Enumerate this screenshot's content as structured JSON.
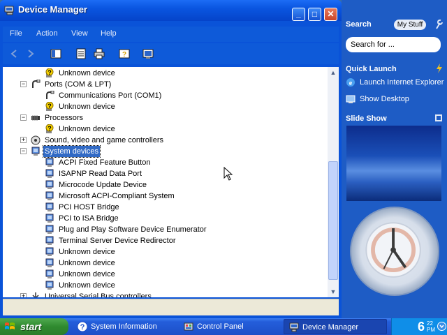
{
  "window": {
    "title": "Device Manager",
    "buttons": {
      "minimize": "_",
      "maximize": "□",
      "close": "✕"
    }
  },
  "menu": [
    "File",
    "Action",
    "View",
    "Help"
  ],
  "toolbar": [
    "back-icon",
    "forward-icon",
    "console-tree-icon",
    "properties-icon",
    "print-icon",
    "help-icon",
    "scan-hardware-icon"
  ],
  "tree": {
    "rows": [
      {
        "label": "Unknown device",
        "indent": 3,
        "icon": "warning-device"
      },
      {
        "label": "Ports (COM & LPT)",
        "indent": 2,
        "icon": "port",
        "expander": "−"
      },
      {
        "label": "Communications Port (COM1)",
        "indent": 3,
        "icon": "port"
      },
      {
        "label": "Unknown device",
        "indent": 3,
        "icon": "warning-device"
      },
      {
        "label": "Processors",
        "indent": 2,
        "icon": "processor",
        "expander": "−"
      },
      {
        "label": "Unknown device",
        "indent": 3,
        "icon": "warning-device"
      },
      {
        "label": "Sound, video and game controllers",
        "indent": 2,
        "icon": "sound",
        "expander": "+"
      },
      {
        "label": "System devices",
        "indent": 2,
        "icon": "system",
        "expander": "−",
        "selected": true
      },
      {
        "label": "ACPI Fixed Feature Button",
        "indent": 3,
        "icon": "system"
      },
      {
        "label": "ISAPNP Read Data Port",
        "indent": 3,
        "icon": "system"
      },
      {
        "label": "Microcode Update Device",
        "indent": 3,
        "icon": "system"
      },
      {
        "label": "Microsoft ACPI-Compliant System",
        "indent": 3,
        "icon": "system"
      },
      {
        "label": "PCI HOST Bridge",
        "indent": 3,
        "icon": "system"
      },
      {
        "label": "PCI to ISA Bridge",
        "indent": 3,
        "icon": "system"
      },
      {
        "label": "Plug and Play Software Device Enumerator",
        "indent": 3,
        "icon": "system"
      },
      {
        "label": "Terminal Server Device Redirector",
        "indent": 3,
        "icon": "system"
      },
      {
        "label": "Unknown device",
        "indent": 3,
        "icon": "system"
      },
      {
        "label": "Unknown device",
        "indent": 3,
        "icon": "system"
      },
      {
        "label": "Unknown device",
        "indent": 3,
        "icon": "system"
      },
      {
        "label": "Unknown device",
        "indent": 3,
        "icon": "system"
      },
      {
        "label": "Universal Serial Bus controllers",
        "indent": 2,
        "icon": "usb",
        "expander": "+"
      }
    ]
  },
  "sidebar": {
    "search_title": "Search",
    "my_stuff": "My Stuff",
    "search_placeholder": "Search for ...",
    "quick_launch_title": "Quick Launch",
    "quick_launch": [
      {
        "label": "Launch Internet Explorer",
        "icon": "ie-icon"
      },
      {
        "label": "Show Desktop",
        "icon": "desktop-icon"
      }
    ],
    "slide_show_title": "Slide Show"
  },
  "taskbar": {
    "start": "start",
    "tasks": [
      {
        "label": "System Information",
        "icon": "help-circle-icon",
        "active": false
      },
      {
        "label": "Control Panel",
        "icon": "control-panel-icon",
        "active": false
      },
      {
        "label": "Device Manager",
        "icon": "device-manager-icon",
        "active": true
      }
    ],
    "clock_hour": "6",
    "clock_minute": "22",
    "clock_ampm": "PM"
  },
  "colors": {
    "titlebar": "#0a55e0",
    "selection": "#316ac5",
    "taskbar": "#245edb",
    "start_green": "#2f8a2f",
    "sidebar": "#1e5cc5"
  }
}
